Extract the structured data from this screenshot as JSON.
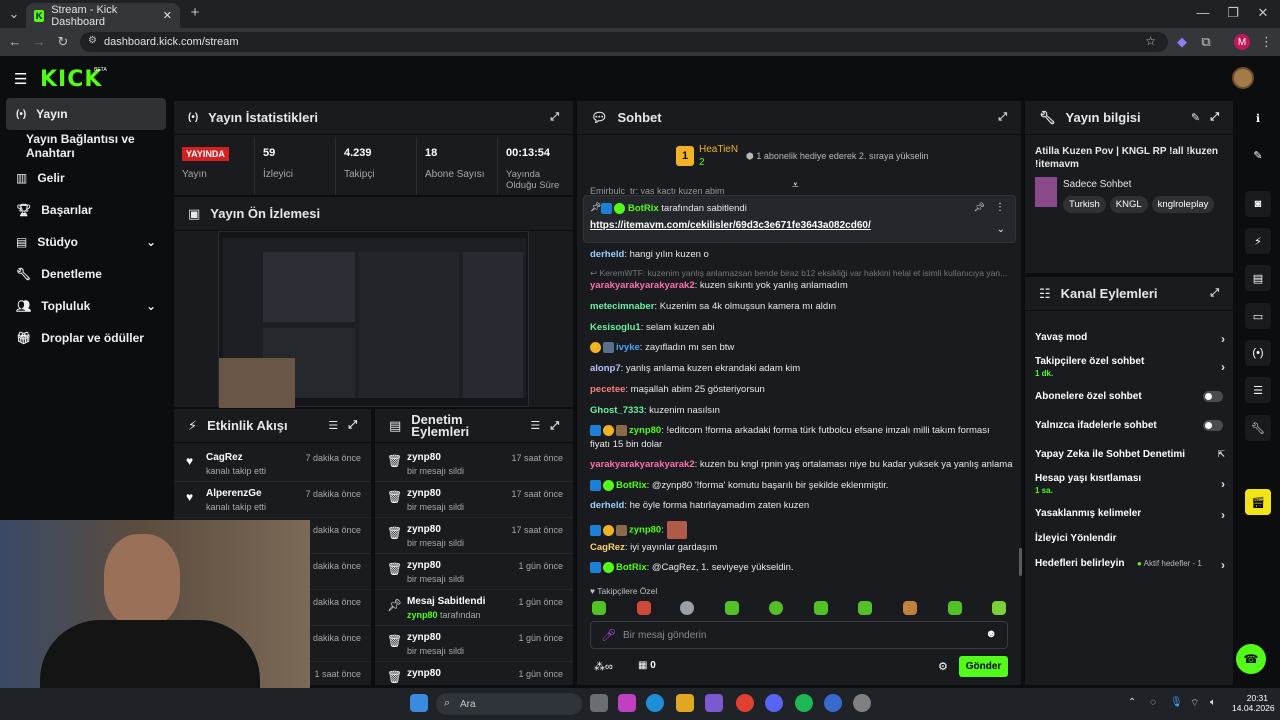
{
  "browser": {
    "tab_title": "Stream - Kick Dashboard",
    "url": "dashboard.kick.com/stream",
    "profile_initial": "M"
  },
  "header": {
    "logo": "KICK",
    "beta": "BETA"
  },
  "sidebar": {
    "items": [
      {
        "label": "Yayın"
      },
      {
        "label": "Yayın Bağlantısı ve Anahtarı"
      },
      {
        "label": "Gelir"
      },
      {
        "label": "Başarılar"
      },
      {
        "label": "Stüdyo"
      },
      {
        "label": "Denetleme"
      },
      {
        "label": "Topluluk"
      },
      {
        "label": "Droplar ve ödüller"
      }
    ]
  },
  "stats": {
    "title": "Yayın İstatistikleri",
    "live_badge": "YAYINDA",
    "items": [
      {
        "value": "",
        "label": "Yayın"
      },
      {
        "value": "59",
        "label": "İzleyici"
      },
      {
        "value": "4.239",
        "label": "Takipçi"
      },
      {
        "value": "18",
        "label": "Abone Sayısı"
      },
      {
        "value": "00:13:54",
        "label": "Yayında Olduğu Süre"
      }
    ]
  },
  "preview": {
    "title": "Yayın Ön İzlemesi"
  },
  "events": {
    "title": "Etkinlik Akışı",
    "rows": [
      {
        "name": "CagRez",
        "sub": "kanalı takip etti",
        "time": "7 dakika önce"
      },
      {
        "name": "AlperenzGe",
        "sub": "kanalı takip etti",
        "time": "7 dakika önce"
      },
      {
        "name": "",
        "sub": "",
        "time": "6 dakika önce"
      },
      {
        "name": "",
        "sub": "",
        "time": "1 dakika önce"
      },
      {
        "name": "",
        "sub": "",
        "time": "5 dakika önce"
      },
      {
        "name": "",
        "sub": "",
        "time": "3 dakika önce"
      },
      {
        "name": "",
        "sub": "",
        "time": "1 saat önce"
      }
    ]
  },
  "mod": {
    "title1": "Denetim",
    "title2": "Eylemleri",
    "rows": [
      {
        "name": "zynp80",
        "sub": "bir mesajı sildi",
        "time": "17 saat önce"
      },
      {
        "name": "zynp80",
        "sub": "bir mesajı sildi",
        "time": "17 saat önce"
      },
      {
        "name": "zynp80",
        "sub": "bir mesajı sildi",
        "time": "17 saat önce"
      },
      {
        "name": "zynp80",
        "sub": "bir mesajı sildi",
        "time": "1 gün önce"
      },
      {
        "name": "Mesaj Sabitlendi",
        "sub2": "zynp80",
        "sub": "tarafından",
        "time": "1 gün önce"
      },
      {
        "name": "zynp80",
        "sub": "bir mesajı sildi",
        "time": "1 gün önce"
      },
      {
        "name": "zynp80",
        "sub": "",
        "time": "1 gün önce"
      }
    ]
  },
  "chat": {
    "title": "Sohbet",
    "gift_user": "HeaTieN",
    "gift_count": "2",
    "gift_text": "1 abonelik hediye ederek 2. sıraya yükselin",
    "pinned_by": "BotRix",
    "pinned_text": "tarafından sabitlendi",
    "pinned_link": "https://itemavm.com/cekilisler/69d3c3e671fe3643a082cd60/",
    "partial_top": "Emirbulc_tr: yaş kaçtı kuzen abim",
    "messages": [
      {
        "user": "derheld",
        "text": "hangi yılın kuzen o",
        "color": "#9ad0ff"
      },
      {
        "user": "",
        "text": "KeremWTF: kuzenim yanlış anlamazsan bende biraz b12 eksikliği var hakkini helal et isimli kullanıcıya yan...",
        "color": "#777"
      },
      {
        "user": "yarakyarakyarakyarak2",
        "text": "kuzen sıkıntı yok yanlış anlamadım",
        "color": "#ff6fb0"
      },
      {
        "user": "metecimnaber",
        "text": "Kuzenim sa 4k olmuşsun kamera mı aldın",
        "color": "#6cf0a0"
      },
      {
        "user": "Kesisoglu1",
        "text": "selam kuzen abi",
        "color": "#6cf0a0"
      },
      {
        "user": "ivyke",
        "text": "zayıfladın mı sen btw",
        "color": "#4aa3ff"
      },
      {
        "user": "alonp7",
        "text": "yanlış anlama kuzen ekrandaki adam kim",
        "color": "#b8c4ff"
      },
      {
        "user": "pecetee",
        "text": "maşallah abim 25 gösteriyorsun",
        "color": "#ff7b7b"
      },
      {
        "user": "Ghost_7333",
        "text": "kuzenim nasılsın",
        "color": "#6cf0a0"
      },
      {
        "user": "zynp80",
        "text": "!editcom !forma arkadaki forma türk futbolcu efsane imzalı milli takım forması",
        "text2": "fiyatı 15 bin dolar",
        "color": "#53fc18"
      },
      {
        "user": "yarakyarakyarakyarak2",
        "text": "kuzen bu kngl rpnin yaş ortalaması niye bu kadar yuksek ya yanlış anlama",
        "color": "#ff6fb0"
      },
      {
        "user": "BotRix",
        "text": "@zynp80 '!forma' komutu başarılı bir şekilde eklenmiştir.",
        "color": "#53fc18"
      },
      {
        "user": "derheld",
        "text": "he öyle forma hatırlayamadım zaten kuzen",
        "color": "#9ad0ff"
      },
      {
        "user": "zynp80",
        "text": "",
        "color": "#53fc18"
      },
      {
        "user": "CagRez",
        "text": "iyi yayınlar gardaşım",
        "color": "#ffd36b"
      },
      {
        "user": "BotRix",
        "text": "@CagRez, 1. seviyeye yükseldin.",
        "color": "#53fc18"
      }
    ],
    "followers_only": "Takipçilere Özel",
    "input_placeholder": "Bir mesaj gönderin",
    "points": "0",
    "send": "Gönder"
  },
  "info": {
    "title": "Yayın bilgisi",
    "stream_title": "Atilla Kuzen Pov | KNGL RP !all !kuzen !itemavm",
    "category": "Sadece Sohbet",
    "tags": [
      "Turkish",
      "KNGL",
      "knglroleplay"
    ]
  },
  "actions": {
    "title": "Kanal Eylemleri",
    "items": [
      {
        "label": "Yavaş mod",
        "sub": "",
        "ctrl": "chev"
      },
      {
        "label": "Takipçilere özel sohbet",
        "sub": "1 dk.",
        "ctrl": "chev"
      },
      {
        "label": "Abonelere özel sohbet",
        "sub": "",
        "ctrl": "toggle"
      },
      {
        "label": "Yalnızca ifadelerle sohbet",
        "sub": "",
        "ctrl": "toggle"
      },
      {
        "label": "Yapay Zeka ile Sohbet Denetimi",
        "sub": "",
        "ctrl": "ext"
      },
      {
        "label": "Hesap yaşı kısıtlaması",
        "sub": "1 sa.",
        "ctrl": "chev"
      },
      {
        "label": "Yasaklanmış kelimeler",
        "sub": "",
        "ctrl": "chev"
      },
      {
        "label": "İzleyici Yönlendir",
        "sub": "",
        "ctrl": "none"
      },
      {
        "label": "Hedefleri belirleyin",
        "sub": "",
        "ctrl": "chev",
        "extra": "Aktif hedefler - 1"
      }
    ]
  },
  "taskbar": {
    "search": "Ara",
    "time": "20:31",
    "date": "14.04.2026"
  }
}
